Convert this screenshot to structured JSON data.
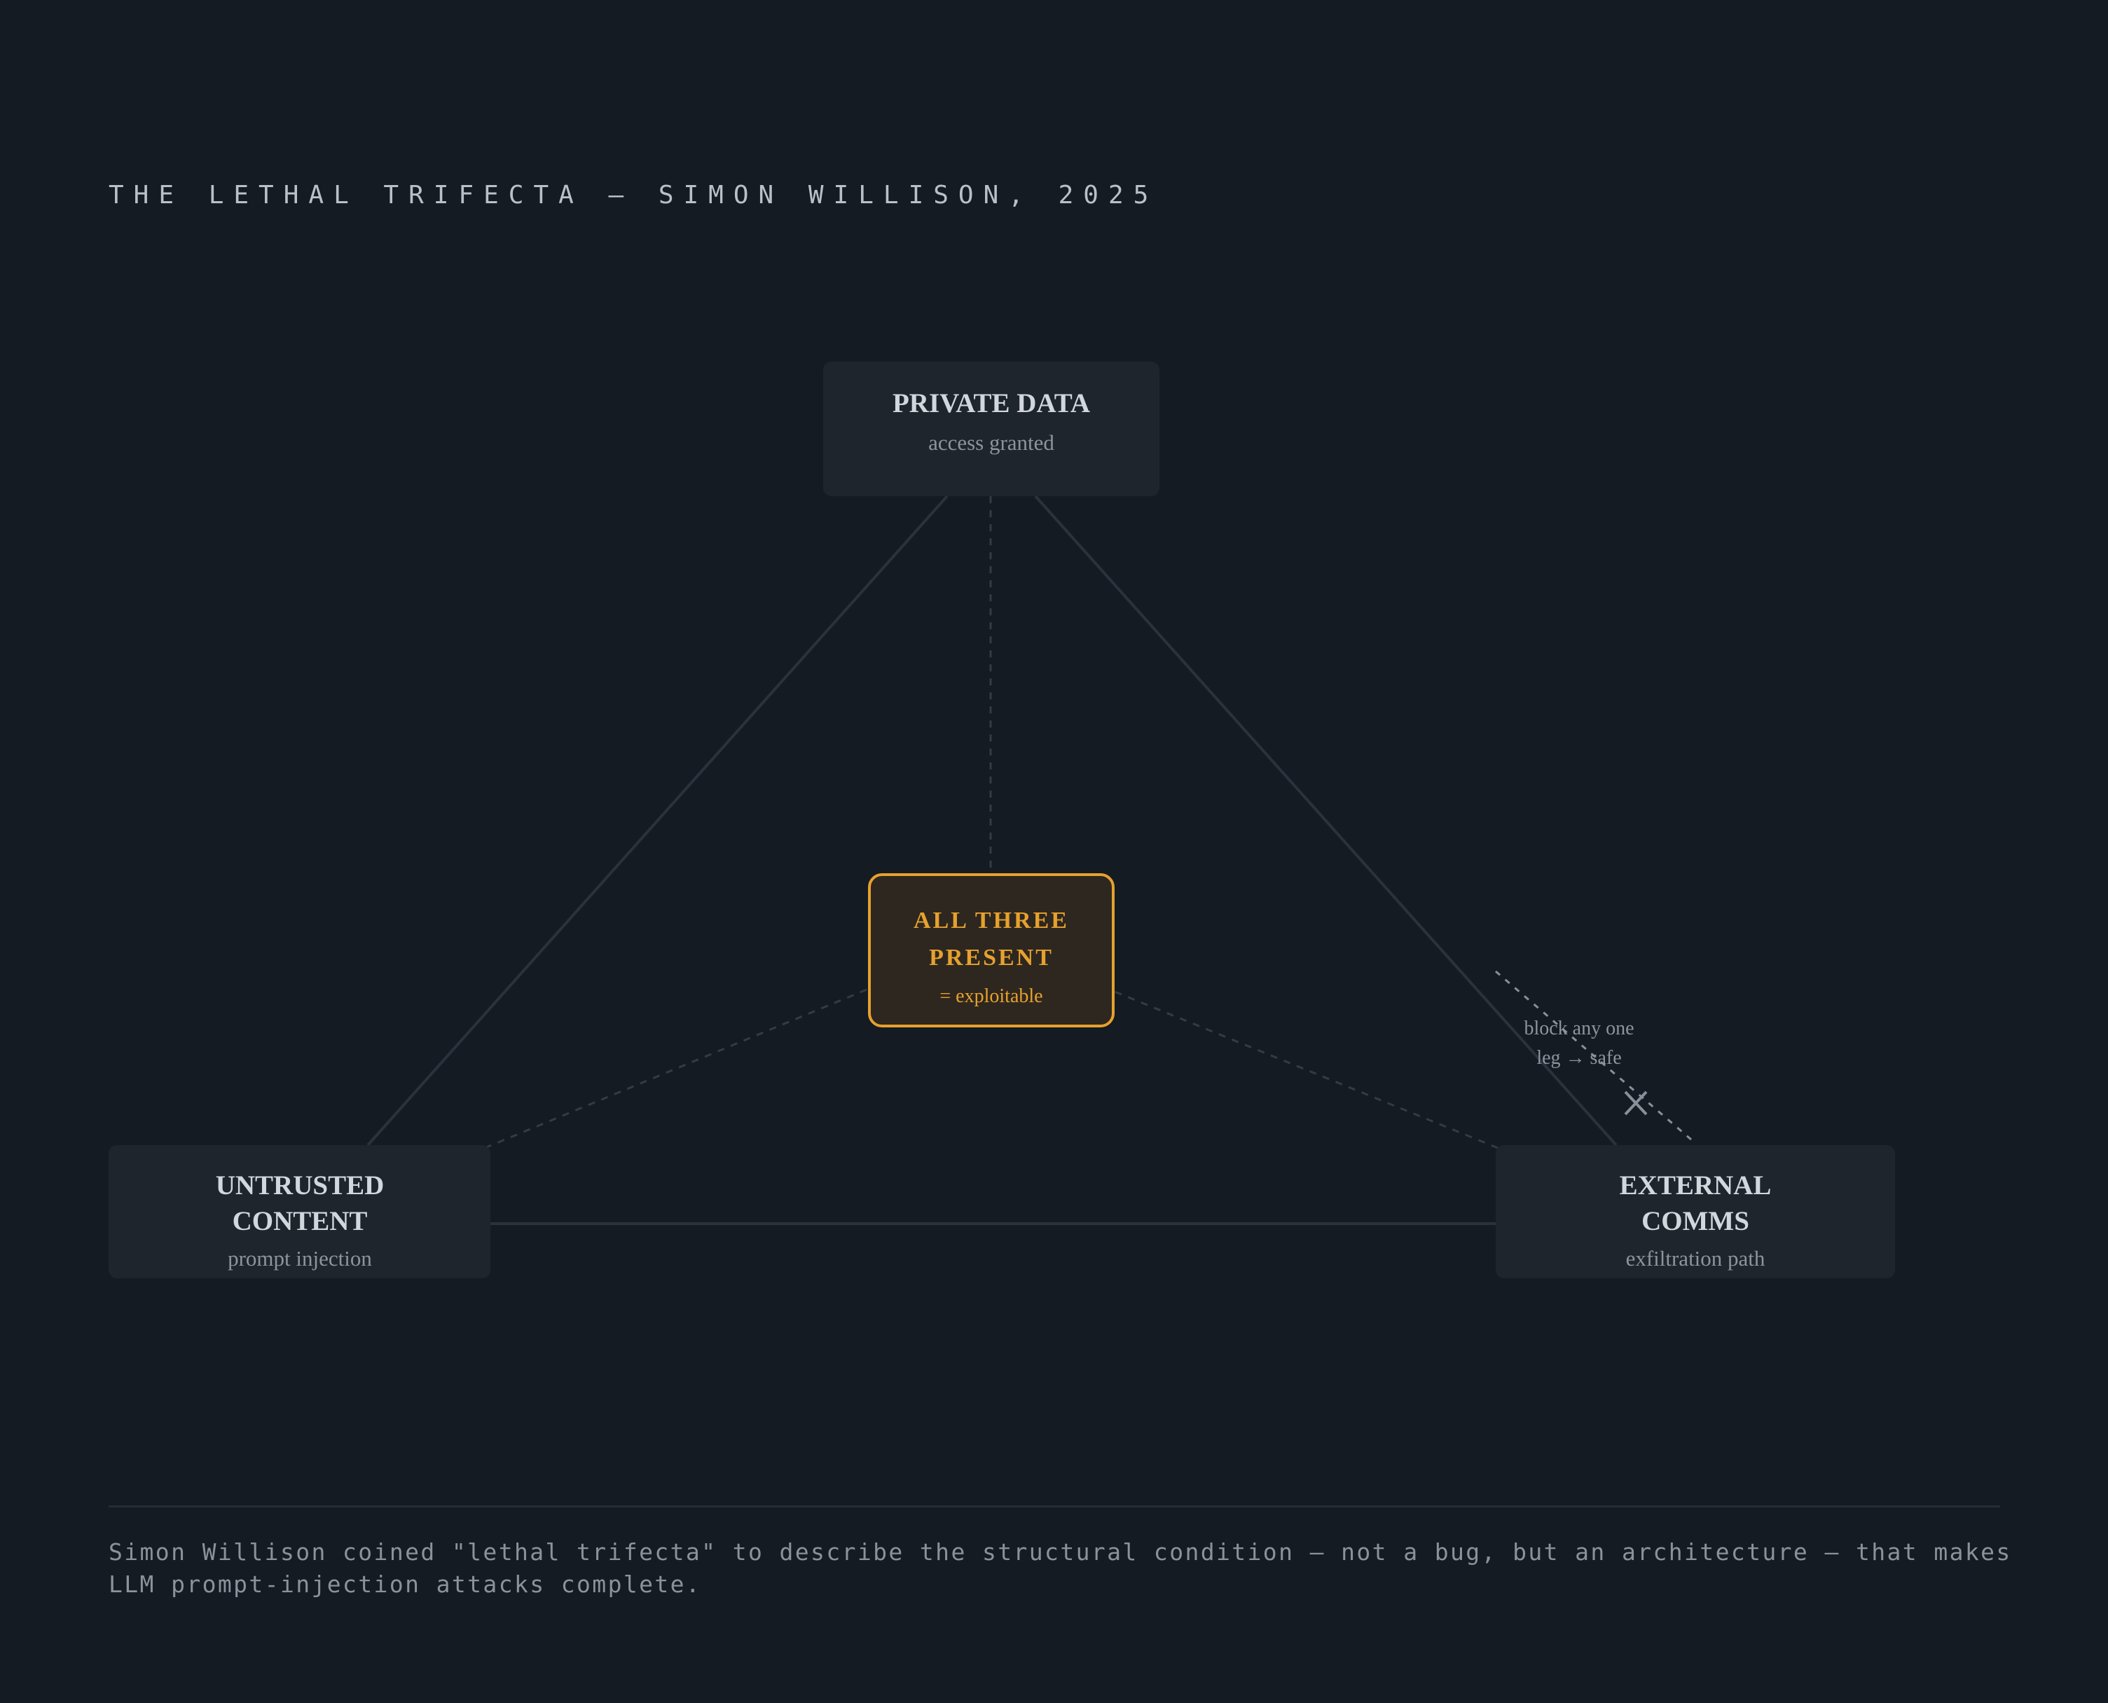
{
  "header": {
    "title": "THE LETHAL TRIFECTA — SIMON WILLISON, 2025"
  },
  "nodes": {
    "private_data": {
      "title": "PRIVATE DATA",
      "subtitle": "access granted"
    },
    "untrusted_content": {
      "title_line1": "UNTRUSTED",
      "title_line2": "CONTENT",
      "subtitle": "prompt injection"
    },
    "external_comms": {
      "title_line1": "EXTERNAL",
      "title_line2": "COMMS",
      "subtitle": "exfiltration path"
    }
  },
  "center": {
    "title_line1": "ALL THREE",
    "title_line2": "PRESENT",
    "subtitle": "= exploitable"
  },
  "annotation": {
    "line1": "block any one",
    "line2": "leg → safe",
    "icon": "close-icon"
  },
  "footer": {
    "caption": "Simon Willison coined \"lethal trifecta\" to describe the structural condition — not a bug, but an architecture — that makes LLM prompt-injection attacks complete."
  },
  "colors": {
    "background": "#151b23",
    "node_fill": "#1f252d",
    "accent": "#e6a12e",
    "edge": "#2b323c"
  }
}
